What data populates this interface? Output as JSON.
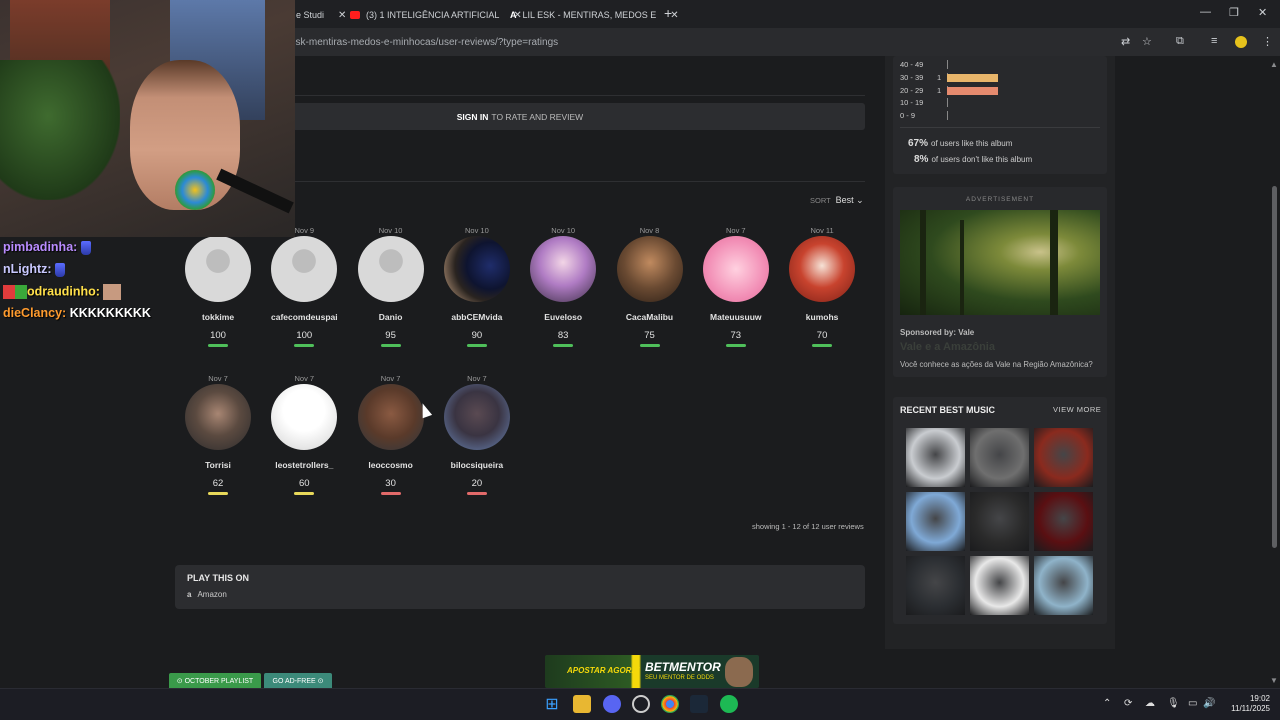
{
  "browser": {
    "tabs": [
      {
        "label": "e Studi",
        "color": "#e8702a"
      },
      {
        "label": "(3) 1 INTELIGÊNCIA ARTIFICIAL",
        "color": "#ff1e1e"
      },
      {
        "label": "LIL ESK - MENTIRAS, MEDOS E",
        "color": "#e6e6e6"
      }
    ],
    "new_tab": "+",
    "url": "esk-mentiras-medos-e-minhocas/user-reviews/?type=ratings",
    "controls": {
      "minimize": "—",
      "maximize": "❐",
      "close": "✕"
    }
  },
  "signin": {
    "bold": "SIGN IN",
    "rest": "TO RATE AND REVIEW"
  },
  "sort": {
    "label": "SORT",
    "value": "Best ⌄"
  },
  "reviews": [
    {
      "date": "",
      "user": "tokkime",
      "score": "100",
      "avatar": "default",
      "bar_color": "#4fbf5a"
    },
    {
      "date": "Nov 9",
      "user": "cafecomdeuspai",
      "score": "100",
      "avatar": "default",
      "bar_color": "#4fbf5a"
    },
    {
      "date": "Nov 10",
      "user": "Danio",
      "score": "95",
      "avatar": "default",
      "bar_color": "#4fbf5a"
    },
    {
      "date": "Nov 10",
      "user": "abbCEMvida",
      "score": "90",
      "avatar": "cat",
      "bar_color": "#4fbf5a"
    },
    {
      "date": "Nov 10",
      "user": "Euveloso",
      "score": "83",
      "avatar": "anime",
      "bar_color": "#4fbf5a"
    },
    {
      "date": "Nov 8",
      "user": "CacaMalibu",
      "score": "75",
      "avatar": "painting",
      "bar_color": "#4fbf5a"
    },
    {
      "date": "Nov 7",
      "user": "Mateuusuuw",
      "score": "73",
      "avatar": "pink",
      "bar_color": "#4fbf5a"
    },
    {
      "date": "Nov 11",
      "user": "kumohs",
      "score": "70",
      "avatar": "red",
      "bar_color": "#4fbf5a"
    },
    {
      "date": "Nov 7",
      "user": "Torrisi",
      "score": "62",
      "avatar": "man",
      "bar_color": "#e8d85a"
    },
    {
      "date": "Nov 7",
      "user": "leostetrollers_",
      "score": "60",
      "avatar": "sketch",
      "bar_color": "#e8d85a"
    },
    {
      "date": "Nov 7",
      "user": "leoccosmo",
      "score": "30",
      "avatar": "man2",
      "bar_color": "#e26a6a"
    },
    {
      "date": "Nov 7",
      "user": "bilocsiqueira",
      "score": "20",
      "avatar": "creature",
      "bar_color": "#e26a6a"
    }
  ],
  "showing": "showing 1 - 12 of 12 user reviews",
  "play": {
    "title": "PLAY THIS ON",
    "service_icon": "a",
    "service": "Amazon"
  },
  "footer_pills": [
    {
      "label": "⊙ OCTOBER PLAYLIST",
      "color": "#3a9a4a"
    },
    {
      "label": "GO AD-FREE ⊙",
      "color": "#3c8a7a"
    }
  ],
  "ad_banner": {
    "line1": "APOSTAR AGORA!",
    "line2": "BETMENTOR",
    "line3": "SEU MENTOR DE ODDS"
  },
  "distribution": [
    {
      "range": "40 - 49",
      "count": "",
      "fraction": 0,
      "color": "#e8b56a"
    },
    {
      "range": "30 - 39",
      "count": "1",
      "fraction": 1,
      "color": "#e8b56a"
    },
    {
      "range": "20 - 29",
      "count": "1",
      "fraction": 1,
      "color": "#e58a6e"
    },
    {
      "range": "10 - 19",
      "count": "",
      "fraction": 0,
      "color": "#e58a6e"
    },
    {
      "range": "0 - 9",
      "count": "",
      "fraction": 0,
      "color": "#e58a6e"
    }
  ],
  "likes": [
    {
      "pct": "67%",
      "text": "of users like this album"
    },
    {
      "pct": "8%",
      "text": "of users don't like this album"
    }
  ],
  "advert": {
    "label": "ADVERTISEMENT",
    "sponsor": "Sponsored by: Vale",
    "title": "Vale e a Amazônia",
    "desc": "Você conhece as ações da Vale na Região Amazônica?"
  },
  "recent": {
    "title": "RECENT BEST MUSIC",
    "view_more": "VIEW MORE",
    "covers": [
      "#c9ccd0",
      "#6f6f6f",
      "#8a2a1e",
      "#7fa9d6",
      "#2a2a2a",
      "#5a0f12",
      "#2b2e32",
      "#e8e8e8",
      "#8fb3c9"
    ]
  },
  "chat": [
    {
      "user": "pimbadinha:",
      "color": "#b98cff",
      "msg": "",
      "emote": "boot"
    },
    {
      "user": "nLightz:",
      "color": "#c9c9ff",
      "msg": "",
      "emote": "boot"
    },
    {
      "user": "odraudinho:",
      "color": "#ffe04a",
      "msg": "",
      "emote": "face",
      "badges": true
    },
    {
      "user": "dieClancy:",
      "color": "#ff9b2e",
      "msg": "KKKKKKKKK",
      "emote": ""
    }
  ],
  "clock": {
    "time": "19:02",
    "date": "11/11/2025"
  }
}
